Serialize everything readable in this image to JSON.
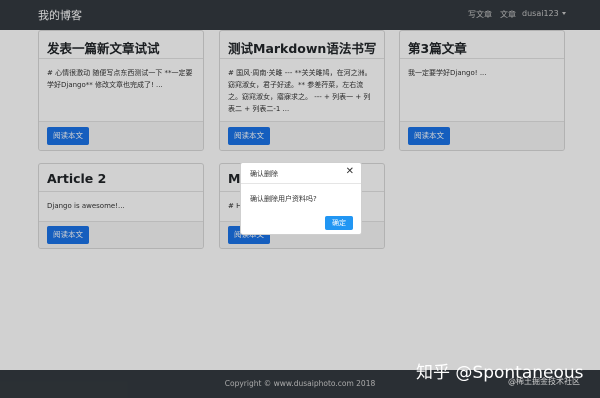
{
  "navbar": {
    "brand": "我的博客",
    "write_link": "写文章",
    "articles_link": "文章",
    "user_menu": "dusai123"
  },
  "articles": [
    {
      "title": "发表一篇新文章试试",
      "excerpt": "# 心情很激动 随便写点东西测试一下 **一定要学好Django** 修改文章也完成了! ...",
      "read_button": "阅读本文"
    },
    {
      "title": "测试Markdown语法书写",
      "excerpt": "# 国风·周南·关雎 --- **关关雎鸠，在河之洲。窈窕淑女，君子好逑。** 参差荇菜，左右流之。窈窕淑女，寤寐求之。 --- + 列表一 + 列表二 + 列表二-1 ...",
      "read_button": "阅读本文"
    },
    {
      "title": "第3篇文章",
      "excerpt": "我一定要学好Django! ...",
      "read_button": "阅读本文"
    },
    {
      "title": "Article 2",
      "excerpt": "Django is awesome!...",
      "read_button": "阅读本文"
    },
    {
      "title": "M",
      "excerpt": "# H",
      "read_button": "阅读本文"
    }
  ],
  "footer": {
    "copyright": "Copyright © www.dusaiphoto.com 2018"
  },
  "modal": {
    "title": "确认删除",
    "close_symbol": "✕",
    "message": "确认删除用户资料吗?",
    "ok_button": "确定"
  },
  "watermark": {
    "main": "知乎 @Spontaneous",
    "sub": "@稀土掘金技术社区"
  },
  "colors": {
    "navbar_bg": "#343a40",
    "button_primary": "#1a73e8",
    "modal_ok": "#2196f3"
  }
}
